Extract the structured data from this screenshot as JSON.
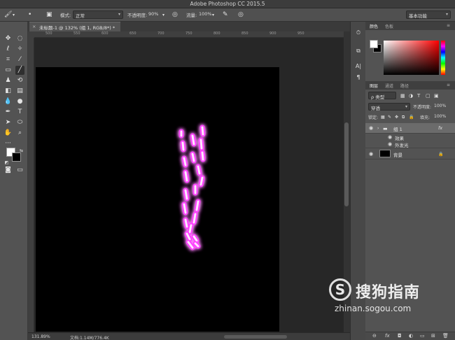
{
  "app": {
    "title": "Adobe Photoshop CC 2015.5"
  },
  "options_bar": {
    "mode_label": "模式:",
    "mode_value": "正常",
    "opacity_label": "不透明度:",
    "opacity_value": "90%",
    "flow_label": "流量:",
    "flow_value": "100%",
    "workspace_value": "基本功能"
  },
  "document": {
    "tab_title": "未标题-1 @ 132% (组 1, RGB/8*) *",
    "close_glyph": "×"
  },
  "ruler": {
    "ticks": [
      "500",
      "550",
      "600",
      "650",
      "700",
      "750",
      "800",
      "850",
      "900",
      "950"
    ]
  },
  "status": {
    "zoom": "131.89%",
    "doc_info": "文档:1.14M/776.4K"
  },
  "color_panel": {
    "tabs": [
      "颜色",
      "色板"
    ],
    "fg_color": "#ffffff",
    "bg_color": "#000000"
  },
  "layers_panel": {
    "tabs": [
      "图层",
      "通道",
      "路径"
    ],
    "filter_label": "ρ 类型",
    "blend_mode": "穿透",
    "opacity_label": "不透明度:",
    "opacity_value": "100%",
    "lock_label": "锁定:",
    "fill_label": "填充:",
    "fill_value": "100%",
    "layers": [
      {
        "name": "组 1",
        "type": "group",
        "fx": "fx",
        "selected": true
      },
      {
        "name": "效果",
        "type": "effects"
      },
      {
        "name": "外发光",
        "type": "effect"
      },
      {
        "name": "背景",
        "type": "background",
        "locked": true
      }
    ]
  },
  "watermark": {
    "brand": "搜狗指南",
    "url": "zhinan.sogou.com",
    "logo_letter": "S"
  },
  "glow": {
    "color": "#ff40ff",
    "core": "#ffe6ff"
  }
}
